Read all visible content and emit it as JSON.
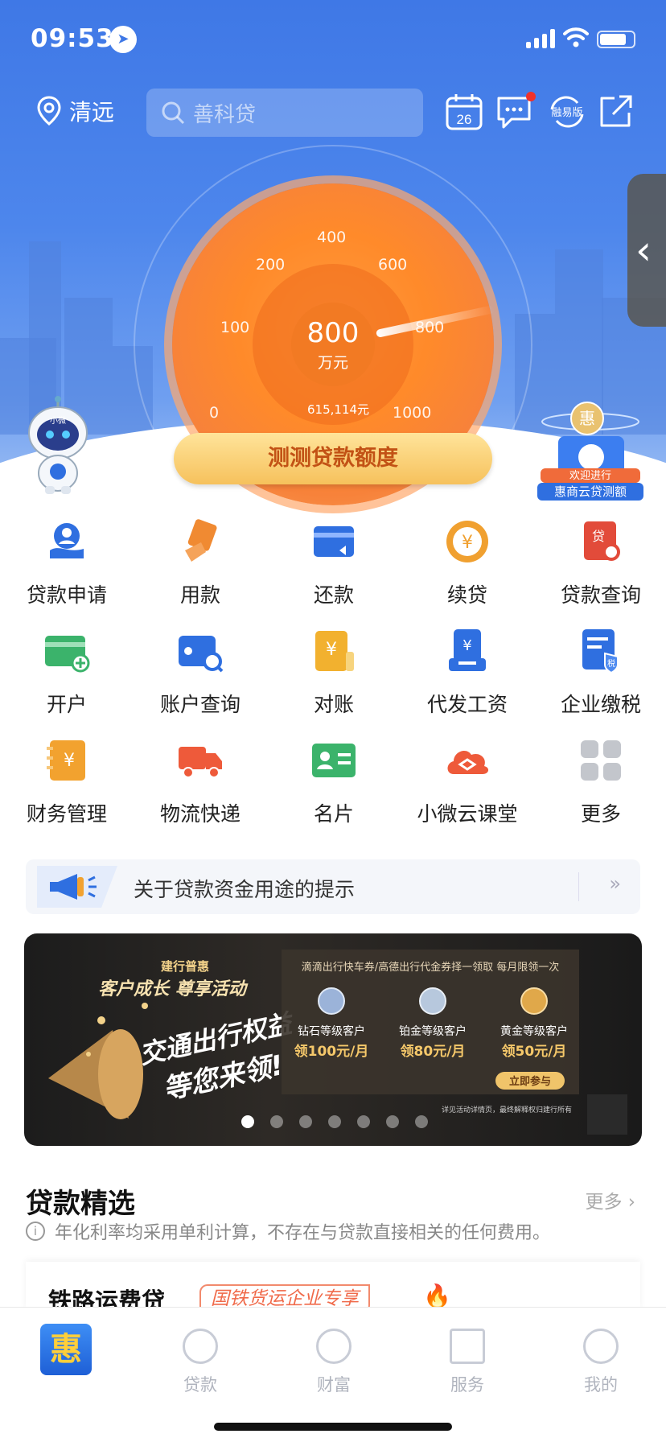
{
  "status_bar": {
    "time": "09:53"
  },
  "header": {
    "location": "清远",
    "search_placeholder": "善科贷",
    "calendar_day": "26",
    "easy_mode": "融易版"
  },
  "gauge": {
    "value": "800",
    "unit": "万元",
    "sub_amount": "615,114元",
    "ticks": [
      "0",
      "100",
      "200",
      "400",
      "600",
      "800",
      "1000"
    ],
    "cta": "测测贷款额度"
  },
  "robot_label": "小微",
  "promo_badge": {
    "line1": "欢迎进行",
    "line2": "惠商云贷测额",
    "badge": "惠"
  },
  "services": [
    [
      {
        "label": "贷款申请",
        "icon": "loan-apply-icon",
        "color": "#2f6fe0"
      },
      {
        "label": "用款",
        "icon": "use-funds-icon",
        "color": "#f08a32"
      },
      {
        "label": "还款",
        "icon": "repay-card-icon",
        "color": "#2f6fe0"
      },
      {
        "label": "续贷",
        "icon": "renew-loan-icon",
        "color": "#f0a030"
      },
      {
        "label": "贷款查询",
        "icon": "loan-query-icon",
        "color": "#e24b3a"
      }
    ],
    [
      {
        "label": "开户",
        "icon": "open-account-icon",
        "color": "#3bb36b"
      },
      {
        "label": "账户查询",
        "icon": "account-query-icon",
        "color": "#2f6fe0"
      },
      {
        "label": "对账",
        "icon": "reconcile-icon",
        "color": "#f2b12f"
      },
      {
        "label": "代发工资",
        "icon": "payroll-icon",
        "color": "#2f6fe0"
      },
      {
        "label": "企业缴税",
        "icon": "tax-icon",
        "color": "#2f6fe0"
      }
    ],
    [
      {
        "label": "财务管理",
        "icon": "finance-icon",
        "color": "#f2a22f"
      },
      {
        "label": "物流快递",
        "icon": "truck-icon",
        "color": "#ee5a3a"
      },
      {
        "label": "名片",
        "icon": "business-card-icon",
        "color": "#3bb36b"
      },
      {
        "label": "小微云课堂",
        "icon": "cloud-class-icon",
        "color": "#ee5a3a"
      },
      {
        "label": "更多",
        "icon": "more-grid-icon",
        "color": "#c3c6cc"
      }
    ]
  ],
  "notice": {
    "text": "关于贷款资金用途的提示",
    "arrow": "»"
  },
  "banner": {
    "brand": "建行普惠",
    "headline1": "客户成长 尊享活动",
    "headline2": "交通出行权益",
    "headline3": "等您来领!",
    "offer": "滴滴出行快车券/高德出行代金券择一领取 每月限领一次",
    "tiers": [
      {
        "name": "钻石等级客户",
        "amount": "领100元/月"
      },
      {
        "name": "铂金等级客户",
        "amount": "领80元/月"
      },
      {
        "name": "黄金等级客户",
        "amount": "领50元/月"
      }
    ],
    "join": "立即参与",
    "fine_print": "详见活动详情页，最终解释权归建行所有",
    "slide_count": 7,
    "active_slide": 1
  },
  "loans": {
    "title": "贷款精选",
    "more": "更多",
    "note": "年化利率均采用单利计算，不存在与贷款直接相关的任何费用。",
    "first_item": {
      "name": "铁路运费贷",
      "tag": "国铁货运企业专享"
    }
  },
  "tabbar": [
    {
      "label": "",
      "icon": "hui-home-icon",
      "logo": "惠"
    },
    {
      "label": "贷款",
      "icon": "loan-tab-icon"
    },
    {
      "label": "财富",
      "icon": "wealth-tab-icon"
    },
    {
      "label": "服务",
      "icon": "service-tab-icon"
    },
    {
      "label": "我的",
      "icon": "profile-tab-icon"
    }
  ]
}
